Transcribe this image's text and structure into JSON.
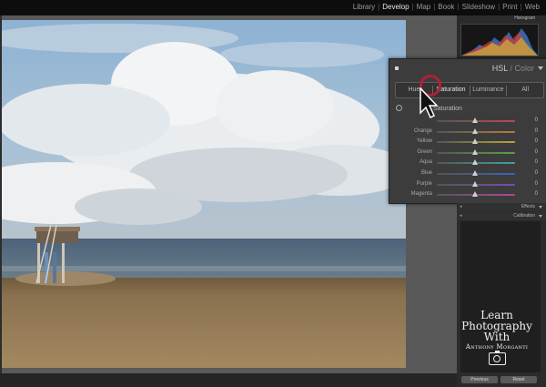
{
  "modules": [
    "Library",
    "Develop",
    "Map",
    "Book",
    "Slideshow",
    "Print",
    "Web"
  ],
  "active_module": "Develop",
  "histogram": {
    "title": "Histogram",
    "info": [
      "",
      "",
      ""
    ]
  },
  "hsl": {
    "title_a": "HSL",
    "title_sep": " / ",
    "title_b": "Color",
    "tabs": [
      "Hue",
      "Saturation",
      "Luminance",
      "All"
    ],
    "active_tab": "Saturation",
    "section_label": "Saturation",
    "sliders": [
      {
        "label": "Red",
        "value": "0",
        "color": "#b84a4a"
      },
      {
        "label": "Orange",
        "value": "0",
        "color": "#bd7a3a"
      },
      {
        "label": "Yellow",
        "value": "0",
        "color": "#b4a838"
      },
      {
        "label": "Green",
        "value": "0",
        "color": "#5aa047"
      },
      {
        "label": "Aqua",
        "value": "0",
        "color": "#3ea3a3"
      },
      {
        "label": "Blue",
        "value": "0",
        "color": "#3e62b4"
      },
      {
        "label": "Purple",
        "value": "0",
        "color": "#7a4ab4"
      },
      {
        "label": "Magenta",
        "value": "0",
        "color": "#b0469a"
      }
    ]
  },
  "panels": {
    "effects": "Effects",
    "calibration": "Calibration"
  },
  "logo": {
    "line1": "Learn",
    "line2": "Photography",
    "line3": "With",
    "line4": "Anthony Morganti"
  },
  "buttons": {
    "previous": "Previous",
    "reset": "Reset"
  }
}
